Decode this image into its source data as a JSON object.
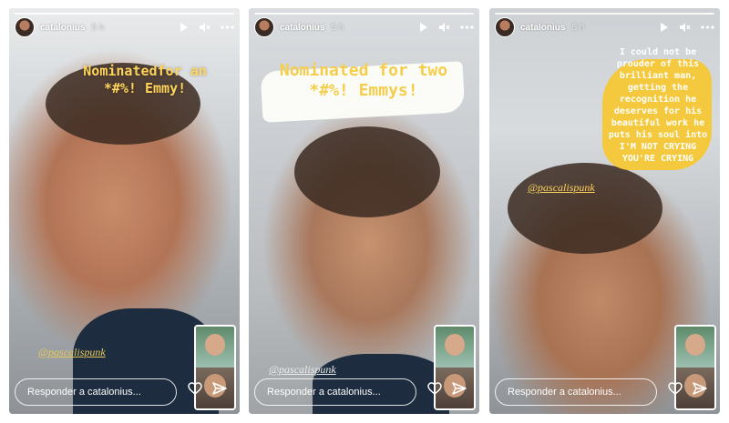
{
  "stories": [
    {
      "username": "catalonius",
      "time": "5 h",
      "caption": "Nominatedfor an *#%! Emmy!",
      "mention": "@pascalispunk",
      "reply_placeholder": "Responder a catalonius..."
    },
    {
      "username": "catalonius",
      "time": "5 h",
      "caption": "Nominated for two *#%! Emmys!",
      "mention": "@pascalispunk",
      "reply_placeholder": "Responder a catalonius..."
    },
    {
      "username": "catalonius",
      "time": "5 h",
      "caption": "I could not be prouder of this brilliant man, getting the recognition he deserves for his beautiful work he puts his soul into I'M NOT CRYING YOU'RE CRYING",
      "mention": "@pascalispunk",
      "reply_placeholder": "Responder a catalonius..."
    }
  ],
  "icons": [
    "play-icon",
    "mute-icon",
    "more-icon",
    "heart-icon",
    "send-icon"
  ]
}
